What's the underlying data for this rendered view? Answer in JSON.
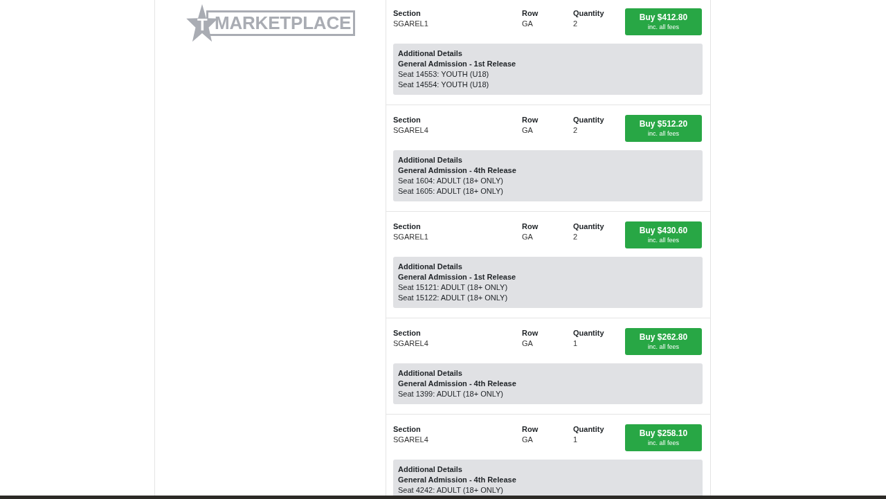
{
  "logo": {
    "mark": "T",
    "wordmark": "MARKETPLACE"
  },
  "listings": [
    {
      "section_label": "Section",
      "section": "SGAREL1",
      "row_label": "Row",
      "row": "GA",
      "quantity_label": "Quantity",
      "quantity": "2",
      "buy_button": {
        "label": "Buy $412.80",
        "note": "inc. all fees"
      },
      "details": {
        "title": "Additional Details",
        "release": "General Admission - 1st Release",
        "seats": [
          "Seat 14553: YOUTH (U18)",
          "Seat 14554: YOUTH (U18)"
        ]
      }
    },
    {
      "section_label": "Section",
      "section": "SGAREL4",
      "row_label": "Row",
      "row": "GA",
      "quantity_label": "Quantity",
      "quantity": "2",
      "buy_button": {
        "label": "Buy $512.20",
        "note": "inc. all fees"
      },
      "details": {
        "title": "Additional Details",
        "release": "General Admission - 4th Release",
        "seats": [
          "Seat 1604: ADULT (18+ ONLY)",
          "Seat 1605: ADULT (18+ ONLY)"
        ]
      }
    },
    {
      "section_label": "Section",
      "section": "SGAREL1",
      "row_label": "Row",
      "row": "GA",
      "quantity_label": "Quantity",
      "quantity": "2",
      "buy_button": {
        "label": "Buy $430.60",
        "note": "inc. all fees"
      },
      "details": {
        "title": "Additional Details",
        "release": "General Admission - 1st Release",
        "seats": [
          "Seat 15121: ADULT (18+ ONLY)",
          "Seat 15122: ADULT (18+ ONLY)"
        ]
      }
    },
    {
      "section_label": "Section",
      "section": "SGAREL4",
      "row_label": "Row",
      "row": "GA",
      "quantity_label": "Quantity",
      "quantity": "1",
      "buy_button": {
        "label": "Buy $262.80",
        "note": "inc. all fees"
      },
      "details": {
        "title": "Additional Details",
        "release": "General Admission - 4th Release",
        "seats": [
          "Seat 1399: ADULT (18+ ONLY)"
        ]
      }
    },
    {
      "section_label": "Section",
      "section": "SGAREL4",
      "row_label": "Row",
      "row": "GA",
      "quantity_label": "Quantity",
      "quantity": "1",
      "buy_button": {
        "label": "Buy $258.10",
        "note": "inc. all fees"
      },
      "details": {
        "title": "Additional Details",
        "release": "General Admission - 4th Release",
        "seats": [
          "Seat 4242: ADULT (18+ ONLY)"
        ]
      }
    }
  ]
}
